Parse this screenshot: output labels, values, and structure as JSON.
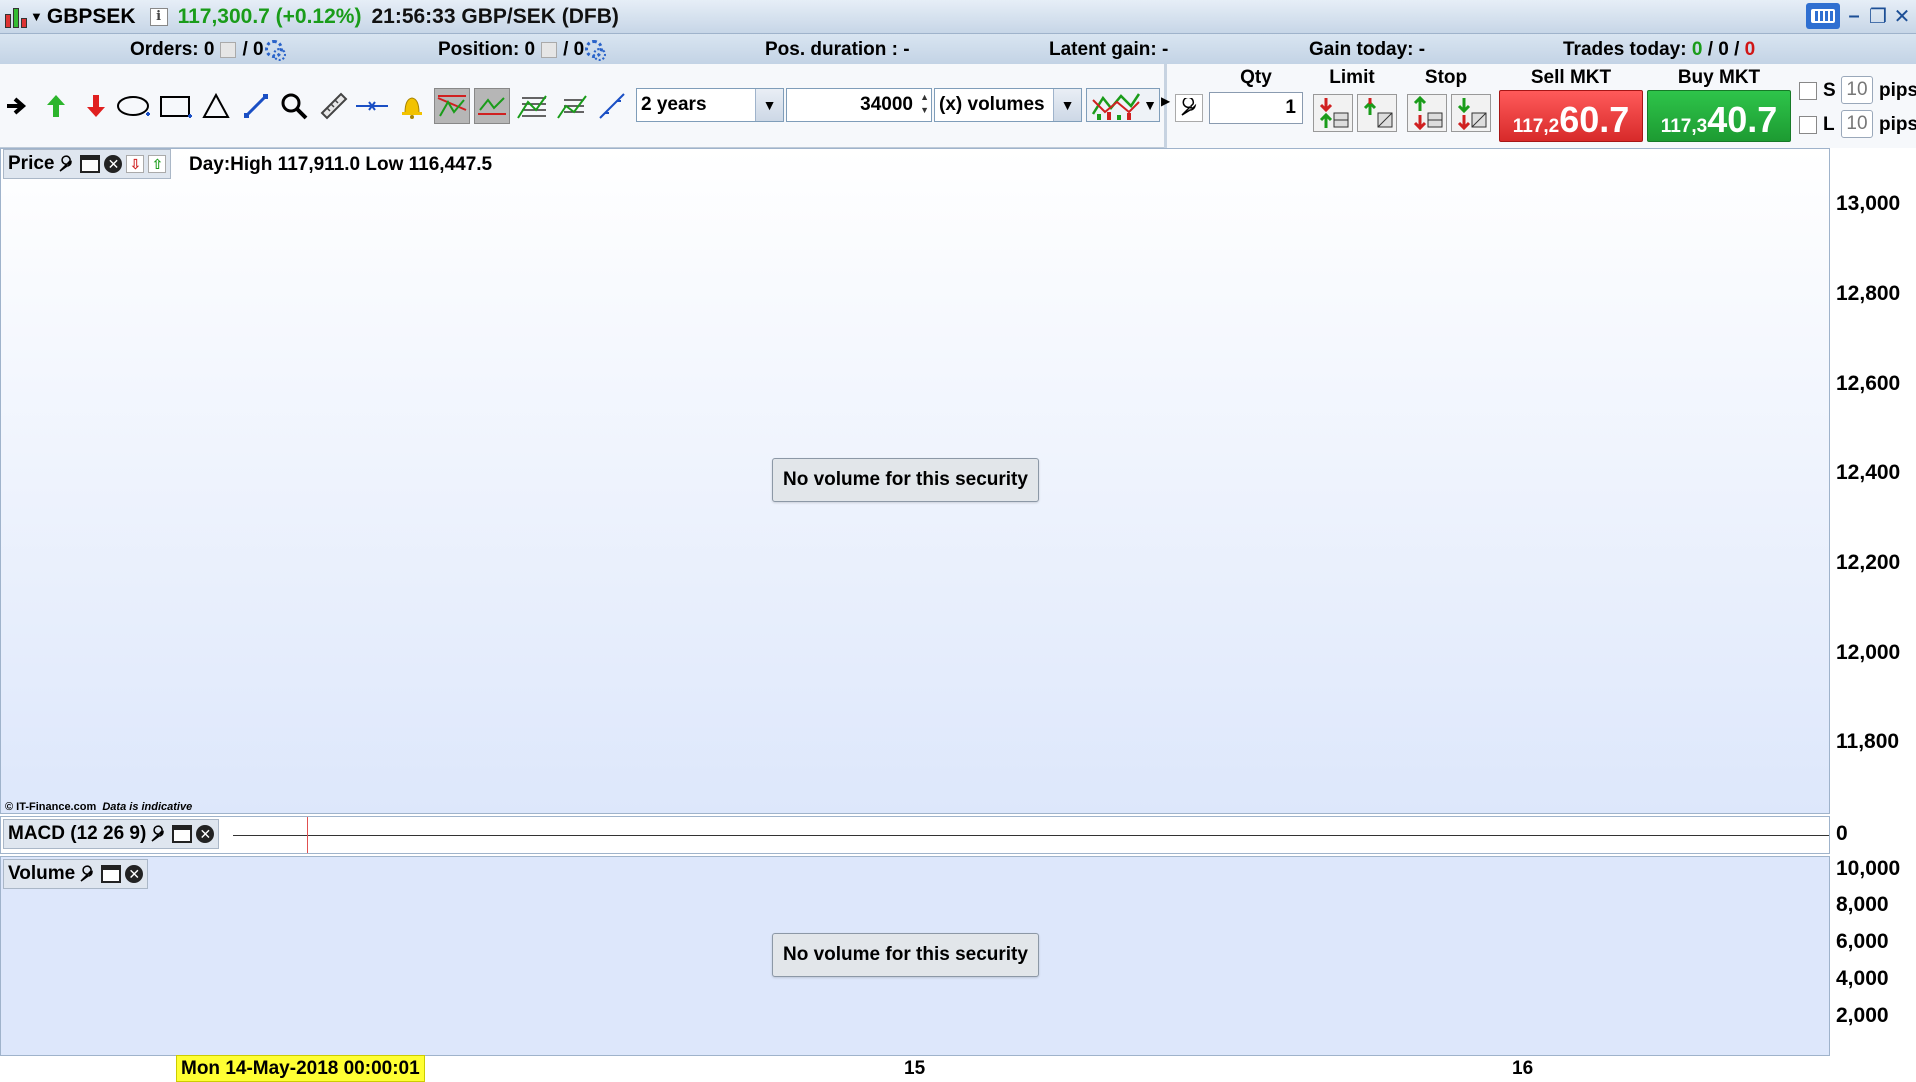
{
  "titlebar": {
    "symbol": "GBPSEK",
    "info_glyph": "i",
    "price": "117,300.7 (+0.12%)",
    "time_and_name": "21:56:33 GBP/SEK (DFB)"
  },
  "status": {
    "orders_label": "Orders: 0",
    "orders_slash": "/ 0",
    "position_label": "Position: 0",
    "position_slash": "/ 0",
    "pos_duration": "Pos. duration : -",
    "latent_gain": "Latent gain: -",
    "gain_today": "Gain today: -",
    "trades_today_label": "Trades today:",
    "trades_a": "0",
    "trades_sep1": "/",
    "trades_b": "0",
    "trades_sep2": "/",
    "trades_c": "0"
  },
  "toolbar": {
    "period": "2 years",
    "bars": "34000",
    "indicator": "(x) volumes"
  },
  "trade": {
    "qty_label": "Qty",
    "qty_value": "1",
    "limit_label": "Limit",
    "stop_label": "Stop",
    "sell_label": "Sell MKT",
    "sell_small": "117,2",
    "sell_big": "60.7",
    "buy_label": "Buy MKT",
    "buy_small": "117,3",
    "buy_big": "40.7",
    "s_label": "S",
    "l_label": "L",
    "s_pips": "10",
    "l_pips": "10",
    "pips_text": "pips"
  },
  "chart": {
    "price_pane_title": "Price",
    "day_info": "Day:High 117,911.0 Low 116,447.5",
    "no_volume": "No volume for this security",
    "copyright": "© IT-Finance.com",
    "indicative": "Data is indicative",
    "price_ticks": [
      "13,000",
      "12,800",
      "12,600",
      "12,400",
      "12,200",
      "12,000",
      "11,800"
    ],
    "macd_title": "MACD (12 26 9)",
    "macd_tick": "0",
    "volume_title": "Volume",
    "volume_ticks": [
      "10,000",
      "8,000",
      "6,000",
      "4,000",
      "2,000"
    ],
    "x_date": "Mon 14-May-2018 00:00:01",
    "x_15": "15",
    "x_16": "16"
  }
}
